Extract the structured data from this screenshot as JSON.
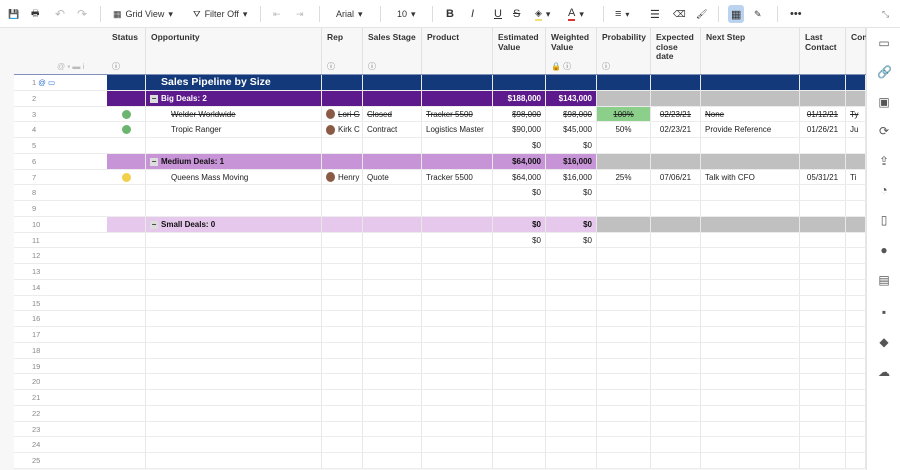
{
  "toolbar": {
    "grid_view": "Grid View",
    "filter": "Filter Off",
    "font": "Arial",
    "size": "10"
  },
  "columns": [
    {
      "key": "status",
      "label": "Status",
      "info": true
    },
    {
      "key": "opportunity",
      "label": "Opportunity"
    },
    {
      "key": "rep",
      "label": "Rep",
      "info": true
    },
    {
      "key": "stage",
      "label": "Sales Stage",
      "info": true
    },
    {
      "key": "product",
      "label": "Product"
    },
    {
      "key": "est",
      "label": "Estimated Value"
    },
    {
      "key": "weighted",
      "label": "Weighted Value",
      "info": true,
      "lock": true
    },
    {
      "key": "prob",
      "label": "Probability",
      "info": true
    },
    {
      "key": "close",
      "label": "Expected close date"
    },
    {
      "key": "next",
      "label": "Next Step"
    },
    {
      "key": "last",
      "label": "Last Contact"
    },
    {
      "key": "con",
      "label": "Con"
    }
  ],
  "colors": {
    "title_bg": "#14397a",
    "big_bg": "#5c1a8c",
    "medium_bg": "#c794d8",
    "small_bg": "#e5c8ec",
    "group_gray": "#c0c0c0",
    "green": "#6cb56f",
    "yellow": "#f2d04b",
    "prob_green": "#8ccf8a"
  },
  "rows": [
    {
      "n": "1",
      "type": "title",
      "opportunity": "Sales Pipeline by Size"
    },
    {
      "n": "2",
      "type": "big",
      "opportunity": "Big Deals: 2",
      "est": "$188,000",
      "weighted": "$143,000"
    },
    {
      "n": "3",
      "type": "data",
      "strike": true,
      "status": "green",
      "opportunity": "Welder Worldwide",
      "rep": "Lori G",
      "stage": "Closed",
      "product": "Tracker 5500",
      "est": "$98,000",
      "weighted": "$98,000",
      "prob": "100%",
      "close": "02/23/21",
      "next": "None",
      "last": "01/12/21",
      "con": "Ty"
    },
    {
      "n": "4",
      "type": "data",
      "status": "green",
      "opportunity": "Tropic Ranger",
      "rep": "Kirk C",
      "stage": "Contract",
      "product": "Logistics Master",
      "est": "$90,000",
      "weighted": "$45,000",
      "prob": "50%",
      "close": "02/23/21",
      "next": "Provide Reference",
      "last": "01/26/21",
      "con": "Ju"
    },
    {
      "n": "5",
      "type": "data",
      "est": "$0",
      "weighted": "$0"
    },
    {
      "n": "6",
      "type": "medium",
      "opportunity": "Medium Deals: 1",
      "est": "$64,000",
      "weighted": "$16,000"
    },
    {
      "n": "7",
      "type": "data",
      "status": "yellow",
      "opportunity": "Queens Mass Moving",
      "rep": "Henry",
      "stage": "Quote",
      "product": "Tracker 5500",
      "est": "$64,000",
      "weighted": "$16,000",
      "prob": "25%",
      "close": "07/06/21",
      "next": "Talk with CFO",
      "last": "05/31/21",
      "con": "Ti"
    },
    {
      "n": "8",
      "type": "data",
      "est": "$0",
      "weighted": "$0"
    },
    {
      "n": "9",
      "type": "data"
    },
    {
      "n": "10",
      "type": "small",
      "opportunity": "Small Deals: 0",
      "est": "$0",
      "weighted": "$0"
    },
    {
      "n": "11",
      "type": "data",
      "est": "$0",
      "weighted": "$0"
    },
    {
      "n": "12",
      "type": "data"
    },
    {
      "n": "13",
      "type": "data"
    },
    {
      "n": "14",
      "type": "data"
    },
    {
      "n": "15",
      "type": "data"
    },
    {
      "n": "16",
      "type": "data"
    },
    {
      "n": "17",
      "type": "data"
    },
    {
      "n": "18",
      "type": "data"
    },
    {
      "n": "19",
      "type": "data"
    },
    {
      "n": "20",
      "type": "data"
    },
    {
      "n": "21",
      "type": "data"
    },
    {
      "n": "22",
      "type": "data"
    },
    {
      "n": "23",
      "type": "data"
    },
    {
      "n": "24",
      "type": "data"
    },
    {
      "n": "25",
      "type": "data"
    }
  ]
}
